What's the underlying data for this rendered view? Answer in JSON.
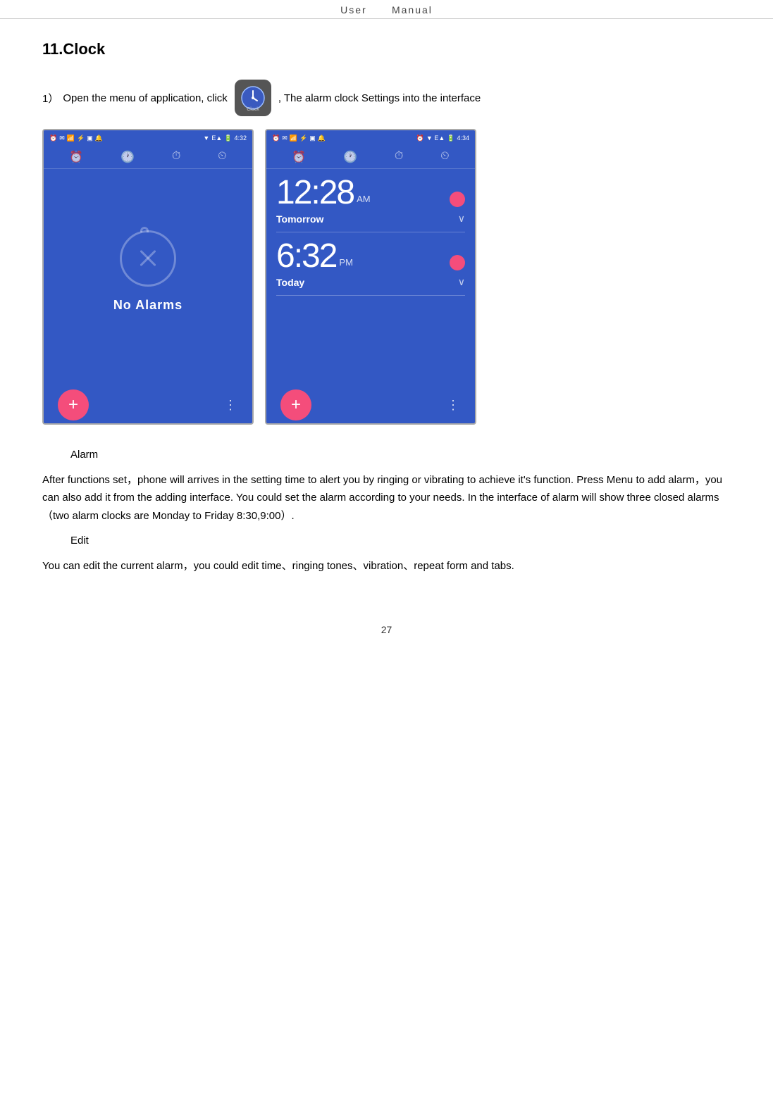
{
  "header": {
    "left": "User",
    "separator": "    ",
    "right": "Manual"
  },
  "section": {
    "title": "11.Clock"
  },
  "step1": {
    "number": "1）",
    "text_before": "Open the menu of application, click",
    "icon_label": "Clock",
    "text_after": ", The alarm clock Settings into the interface"
  },
  "screen_left": {
    "status_time": "4:32",
    "status_icons": "▼ E▲  🔋",
    "tabs": [
      "⏰",
      "🕐",
      "⏱",
      "⏰"
    ],
    "no_alarms_text": "No Alarms",
    "fab_label": "+",
    "more_label": "⋮"
  },
  "screen_right": {
    "status_time": "4:34",
    "status_icons": "▼ E▲  🔋",
    "alarm1": {
      "time": "12:28",
      "ampm": "AM",
      "label": "Tomorrow",
      "enabled": true
    },
    "alarm2": {
      "time": "6:32",
      "ampm": "PM",
      "label": "Today",
      "enabled": true
    },
    "fab_label": "+",
    "more_label": "⋮"
  },
  "body": {
    "heading_alarm": "Alarm",
    "para1": "After functions set，phone will arrives in the setting time to alert you by ringing or vibrating to achieve it's function. Press Menu to add alarm，you can also add it from the adding interface. You could set the alarm according to your needs. In the interface of alarm will show three closed alarms（two alarm clocks are Monday to Friday 8:30,9:00）.",
    "heading_edit": "Edit",
    "para2": "You can edit the current alarm，you could edit time、ringing tones、vibration、repeat form and tabs."
  },
  "page_number": "27"
}
